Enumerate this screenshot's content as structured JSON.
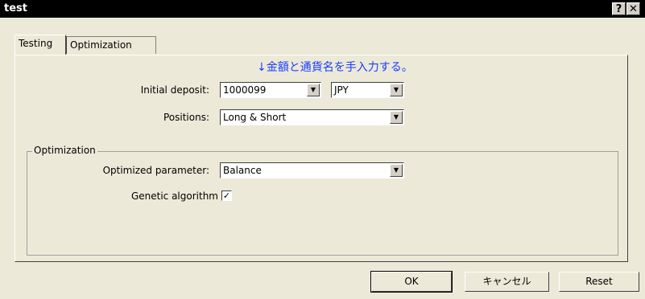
{
  "window": {
    "title": "test",
    "help_glyph": "?",
    "close_glyph": "✕"
  },
  "tabs": [
    {
      "label": "Testing",
      "active": true
    },
    {
      "label": "Optimization",
      "active": false
    }
  ],
  "testing": {
    "note": "↓金額と通貨名を手入力する。",
    "note_color": "#1a3cff",
    "initial_deposit_label": "Initial deposit:",
    "initial_deposit_value": "1000099",
    "currency_value": "JPY",
    "positions_label": "Positions:",
    "positions_value": "Long & Short",
    "optimization_group_label": "Optimization",
    "optimized_parameter_label": "Optimized parameter:",
    "optimized_parameter_value": "Balance",
    "genetic_algorithm_label": "Genetic algorithm",
    "genetic_algorithm_checked": true
  },
  "buttons": {
    "ok": "OK",
    "cancel": "キャンセル",
    "reset": "Reset"
  },
  "icons": {
    "dropdown": "chevron-down-icon",
    "check": "checkmark-icon"
  }
}
